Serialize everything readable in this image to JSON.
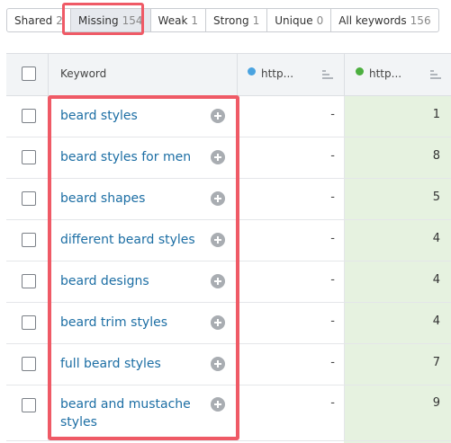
{
  "tabs": [
    {
      "label": "Shared",
      "count": "2"
    },
    {
      "label": "Missing",
      "count": "154"
    },
    {
      "label": "Weak",
      "count": "1"
    },
    {
      "label": "Strong",
      "count": "1"
    },
    {
      "label": "Unique",
      "count": "0"
    },
    {
      "label": "All keywords",
      "count": "156"
    }
  ],
  "active_tab": "Missing",
  "table": {
    "headers": {
      "keyword": "Keyword",
      "domain1": "http...",
      "domain2": "http..."
    },
    "domain_colors": {
      "domain1": "#4aa3e0",
      "domain2": "#4caf3f"
    },
    "rows": [
      {
        "keyword": "beard styles",
        "domain1": "-",
        "domain2": "1"
      },
      {
        "keyword": "beard styles for men",
        "domain1": "-",
        "domain2": "8"
      },
      {
        "keyword": "beard shapes",
        "domain1": "-",
        "domain2": "5"
      },
      {
        "keyword": "different beard styles",
        "domain1": "-",
        "domain2": "4"
      },
      {
        "keyword": "beard designs",
        "domain1": "-",
        "domain2": "4"
      },
      {
        "keyword": "beard trim styles",
        "domain1": "-",
        "domain2": "4"
      },
      {
        "keyword": "full beard styles",
        "domain1": "-",
        "domain2": "7"
      },
      {
        "keyword": "beard and mustache styles",
        "domain1": "-",
        "domain2": "9"
      }
    ]
  }
}
